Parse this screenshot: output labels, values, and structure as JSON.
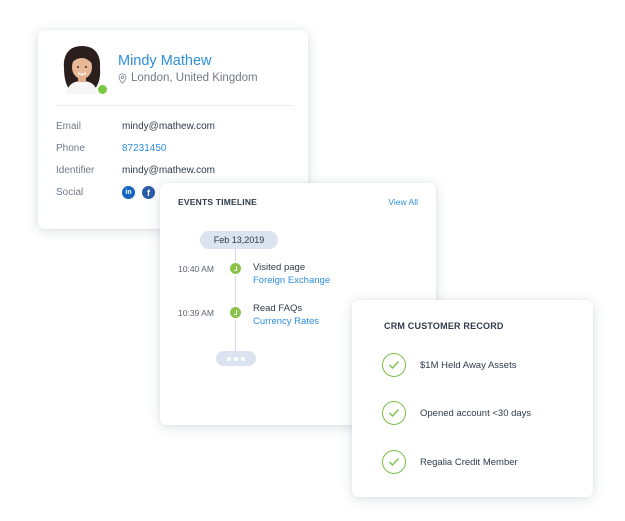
{
  "profile": {
    "name": "Mindy Mathew",
    "location": "London, United Kingdom",
    "status_color": "#7ac943",
    "fields": [
      {
        "label": "Email",
        "value": "mindy@mathew.com"
      },
      {
        "label": "Phone",
        "value": "87231450"
      },
      {
        "label": "Identifier",
        "value": "mindy@mathew.com"
      },
      {
        "label": "Social",
        "value": ""
      }
    ],
    "social": [
      {
        "icon": "linkedin-icon",
        "glyph": "in"
      },
      {
        "icon": "facebook-icon",
        "glyph": "f"
      }
    ]
  },
  "events": {
    "title": "EVENTS TIMELINE",
    "view_all": "View All",
    "date": "Feb 13,2019",
    "items": [
      {
        "time": "10:40 AM",
        "action": "Visited page",
        "target": "Foreign Exchange"
      },
      {
        "time": "10:39 AM",
        "action": "Read FAQs",
        "target": "Currency Rates"
      }
    ]
  },
  "crm": {
    "title": "CRM CUSTOMER RECORD",
    "items": [
      "$1M Held Away Assets",
      "Opened account <30 days",
      "Regalia Credit Member"
    ],
    "check_color": "#7cc049"
  },
  "accent_color": "#2d8fdc"
}
